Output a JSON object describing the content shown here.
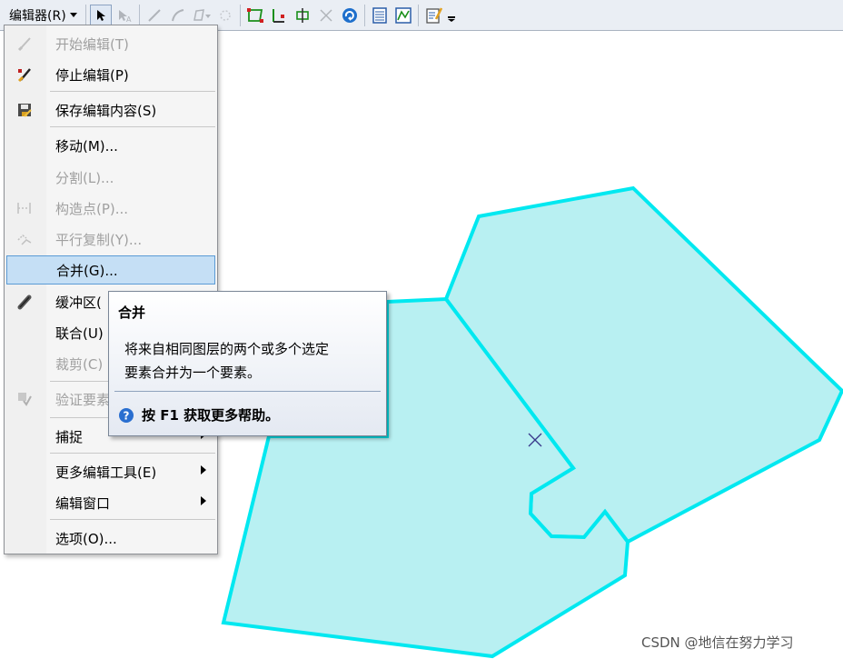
{
  "toolbar": {
    "editor_menu_label": "编辑器(R)",
    "icons": [
      "edit-tool-icon",
      "edit-annotation-tool-icon",
      "straight-segment-icon",
      "end-point-arc-icon",
      "construction-tools-icon",
      "reshape-feature-icon",
      "topology-edit-icon",
      "modify-edge-icon",
      "edit-vertices-icon",
      "cut-polygons-icon",
      "rotate-icon",
      "attributes-icon",
      "sketch-properties-icon",
      "editor-window-icon"
    ]
  },
  "menu": {
    "items": [
      {
        "label": "开始编辑(T)",
        "disabled": true,
        "icon": "start-editing-icon"
      },
      {
        "label": "停止编辑(P)",
        "disabled": false,
        "icon": "stop-editing-icon"
      },
      {
        "label": "保存编辑内容(S)",
        "disabled": false,
        "icon": "save-edits-icon"
      },
      {
        "label": "移动(M)...",
        "disabled": false,
        "icon": ""
      },
      {
        "label": "分割(L)...",
        "disabled": true,
        "icon": ""
      },
      {
        "label": "构造点(P)...",
        "disabled": true,
        "icon": "construct-points-icon"
      },
      {
        "label": "平行复制(Y)...",
        "disabled": true,
        "icon": "copy-parallel-icon"
      },
      {
        "label": "合并(G)...",
        "disabled": false,
        "icon": "",
        "highlighted": true
      },
      {
        "label": "缓冲区(",
        "disabled": false,
        "icon": "buffer-icon"
      },
      {
        "label": "联合(U)",
        "disabled": false,
        "icon": ""
      },
      {
        "label": "裁剪(C)",
        "disabled": true,
        "icon": ""
      },
      {
        "label": "验证要素",
        "disabled": true,
        "icon": "validate-features-icon"
      },
      {
        "label": "捕捉",
        "disabled": false,
        "icon": "",
        "submenu": true
      },
      {
        "label": "更多编辑工具(E)",
        "disabled": false,
        "icon": "",
        "submenu": true
      },
      {
        "label": "编辑窗口",
        "disabled": false,
        "icon": "",
        "submenu": true
      },
      {
        "label": "选项(O)...",
        "disabled": false,
        "icon": ""
      }
    ]
  },
  "tooltip": {
    "title": "合并",
    "body_line1": "将来自相同图层的两个或多个选定",
    "body_line2": "要素合并为一个要素。",
    "help": "按 F1 获取更多帮助。"
  },
  "map": {
    "fill_color": "#b8f0f2",
    "stroke_color": "#00e8f0"
  },
  "watermark": "CSDN @地信在努力学习"
}
